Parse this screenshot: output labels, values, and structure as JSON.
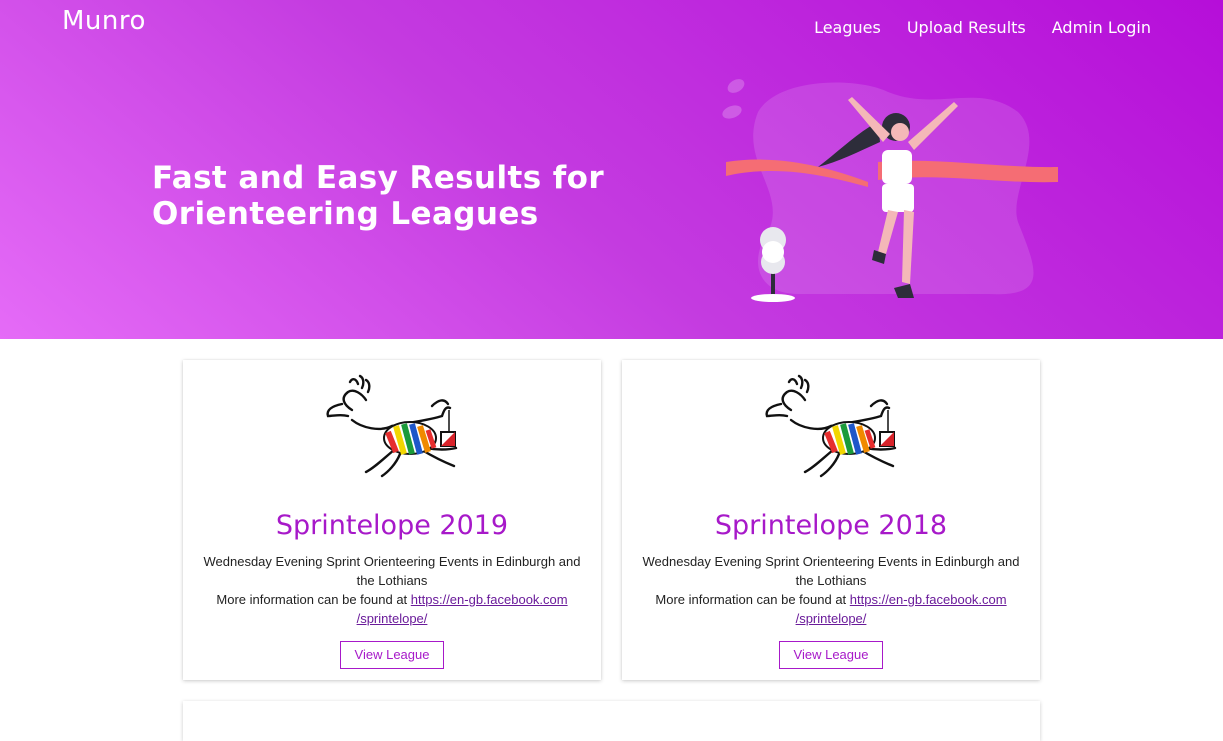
{
  "navbar": {
    "brand": "Munro",
    "links": [
      "Leagues",
      "Upload Results",
      "Admin Login"
    ]
  },
  "hero": {
    "title_line1": "Fast and Easy Results for",
    "title_line2": "Orienteering Leagues"
  },
  "leagues": [
    {
      "title": "Sprintelope 2019",
      "description_line1": "Wednesday Evening Sprint Orienteering Events in Edinburgh and",
      "description_line2": "the Lothians",
      "more_info_prefix": "More information can be found at ",
      "link_line1": "https://en-gb.facebook.com",
      "link_line2": "/sprintelope/",
      "button": "View League"
    },
    {
      "title": "Sprintelope 2018",
      "description_line1": "Wednesday Evening Sprint Orienteering Events in Edinburgh and",
      "description_line2": "the Lothians",
      "more_info_prefix": "More information can be found at ",
      "link_line1": "https://en-gb.facebook.com",
      "link_line2": "/sprintelope/",
      "button": "View League"
    }
  ],
  "colors": {
    "accent": "#a719c9",
    "hero_start": "#e56bf7",
    "hero_end": "#b60ed9",
    "ribbon": "#f56d74"
  },
  "icons": [
    "runner-illustration",
    "antelope-logo"
  ]
}
